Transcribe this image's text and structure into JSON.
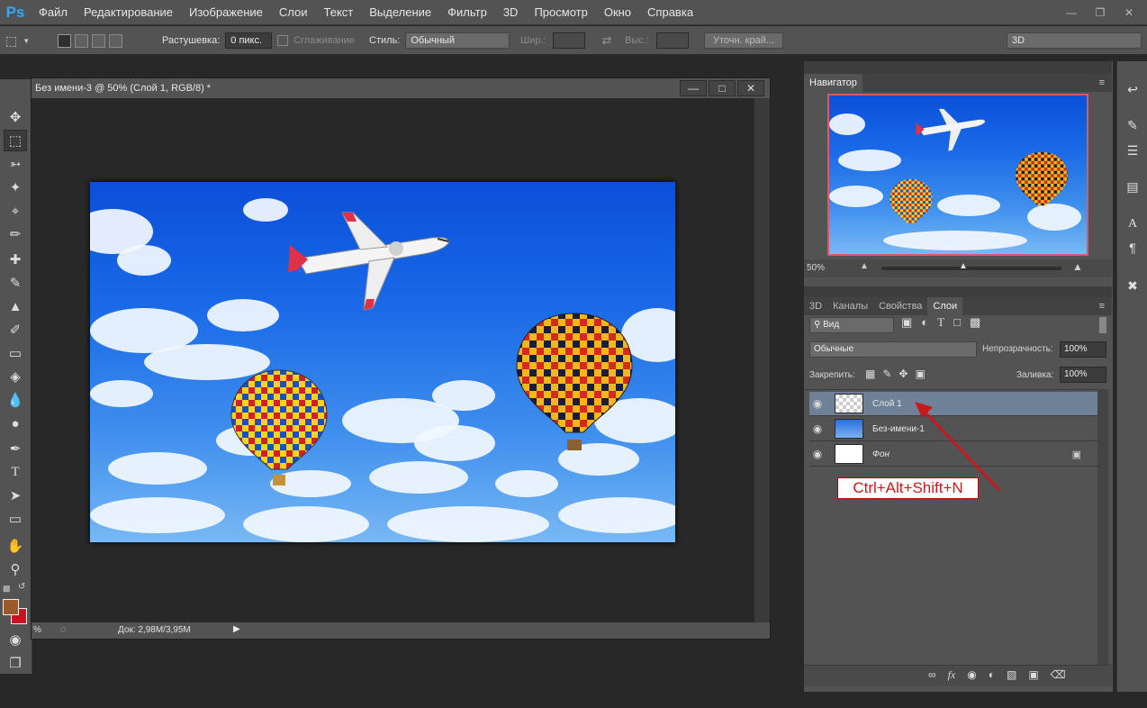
{
  "menu": {
    "logo": "Ps",
    "items": [
      "Файл",
      "Редактирование",
      "Изображение",
      "Слои",
      "Текст",
      "Выделение",
      "Фильтр",
      "3D",
      "Просмотр",
      "Окно",
      "Справка"
    ]
  },
  "options": {
    "feather_label": "Растушевка:",
    "feather_value": "0 пикс.",
    "antialias_label": "Сглаживание",
    "style_label": "Стиль:",
    "style_value": "Обычный",
    "width_label": "Шир.:",
    "height_label": "Выс.:",
    "refine_edge": "Уточн. край...",
    "workspace": "3D"
  },
  "document": {
    "title": "Без имени-3 @ 50% (Слой 1, RGB/8) *",
    "zoom_status": "%",
    "doc_info": "Док: 2,98M/3,95M"
  },
  "navigator": {
    "tab": "Навигатор",
    "zoom": "50%"
  },
  "layers_panel": {
    "tabs": [
      "3D",
      "Каналы",
      "Свойства",
      "Слои"
    ],
    "filter_kind": "Вид",
    "blend_mode": "Обычные",
    "opacity_label": "Непрозрачность:",
    "opacity_value": "100%",
    "lock_label": "Закрепить:",
    "fill_label": "Заливка:",
    "fill_value": "100%",
    "layers": [
      {
        "name": "Слой 1"
      },
      {
        "name": "Без-имени-1"
      },
      {
        "name": "Фон"
      }
    ]
  },
  "annotation": {
    "shortcut": "Ctrl+Alt+Shift+N",
    "color": "#c8181e"
  },
  "colors": {
    "foreground": "#9a5a2a",
    "background": "#d01020",
    "selected_layer": "#6e8196"
  }
}
